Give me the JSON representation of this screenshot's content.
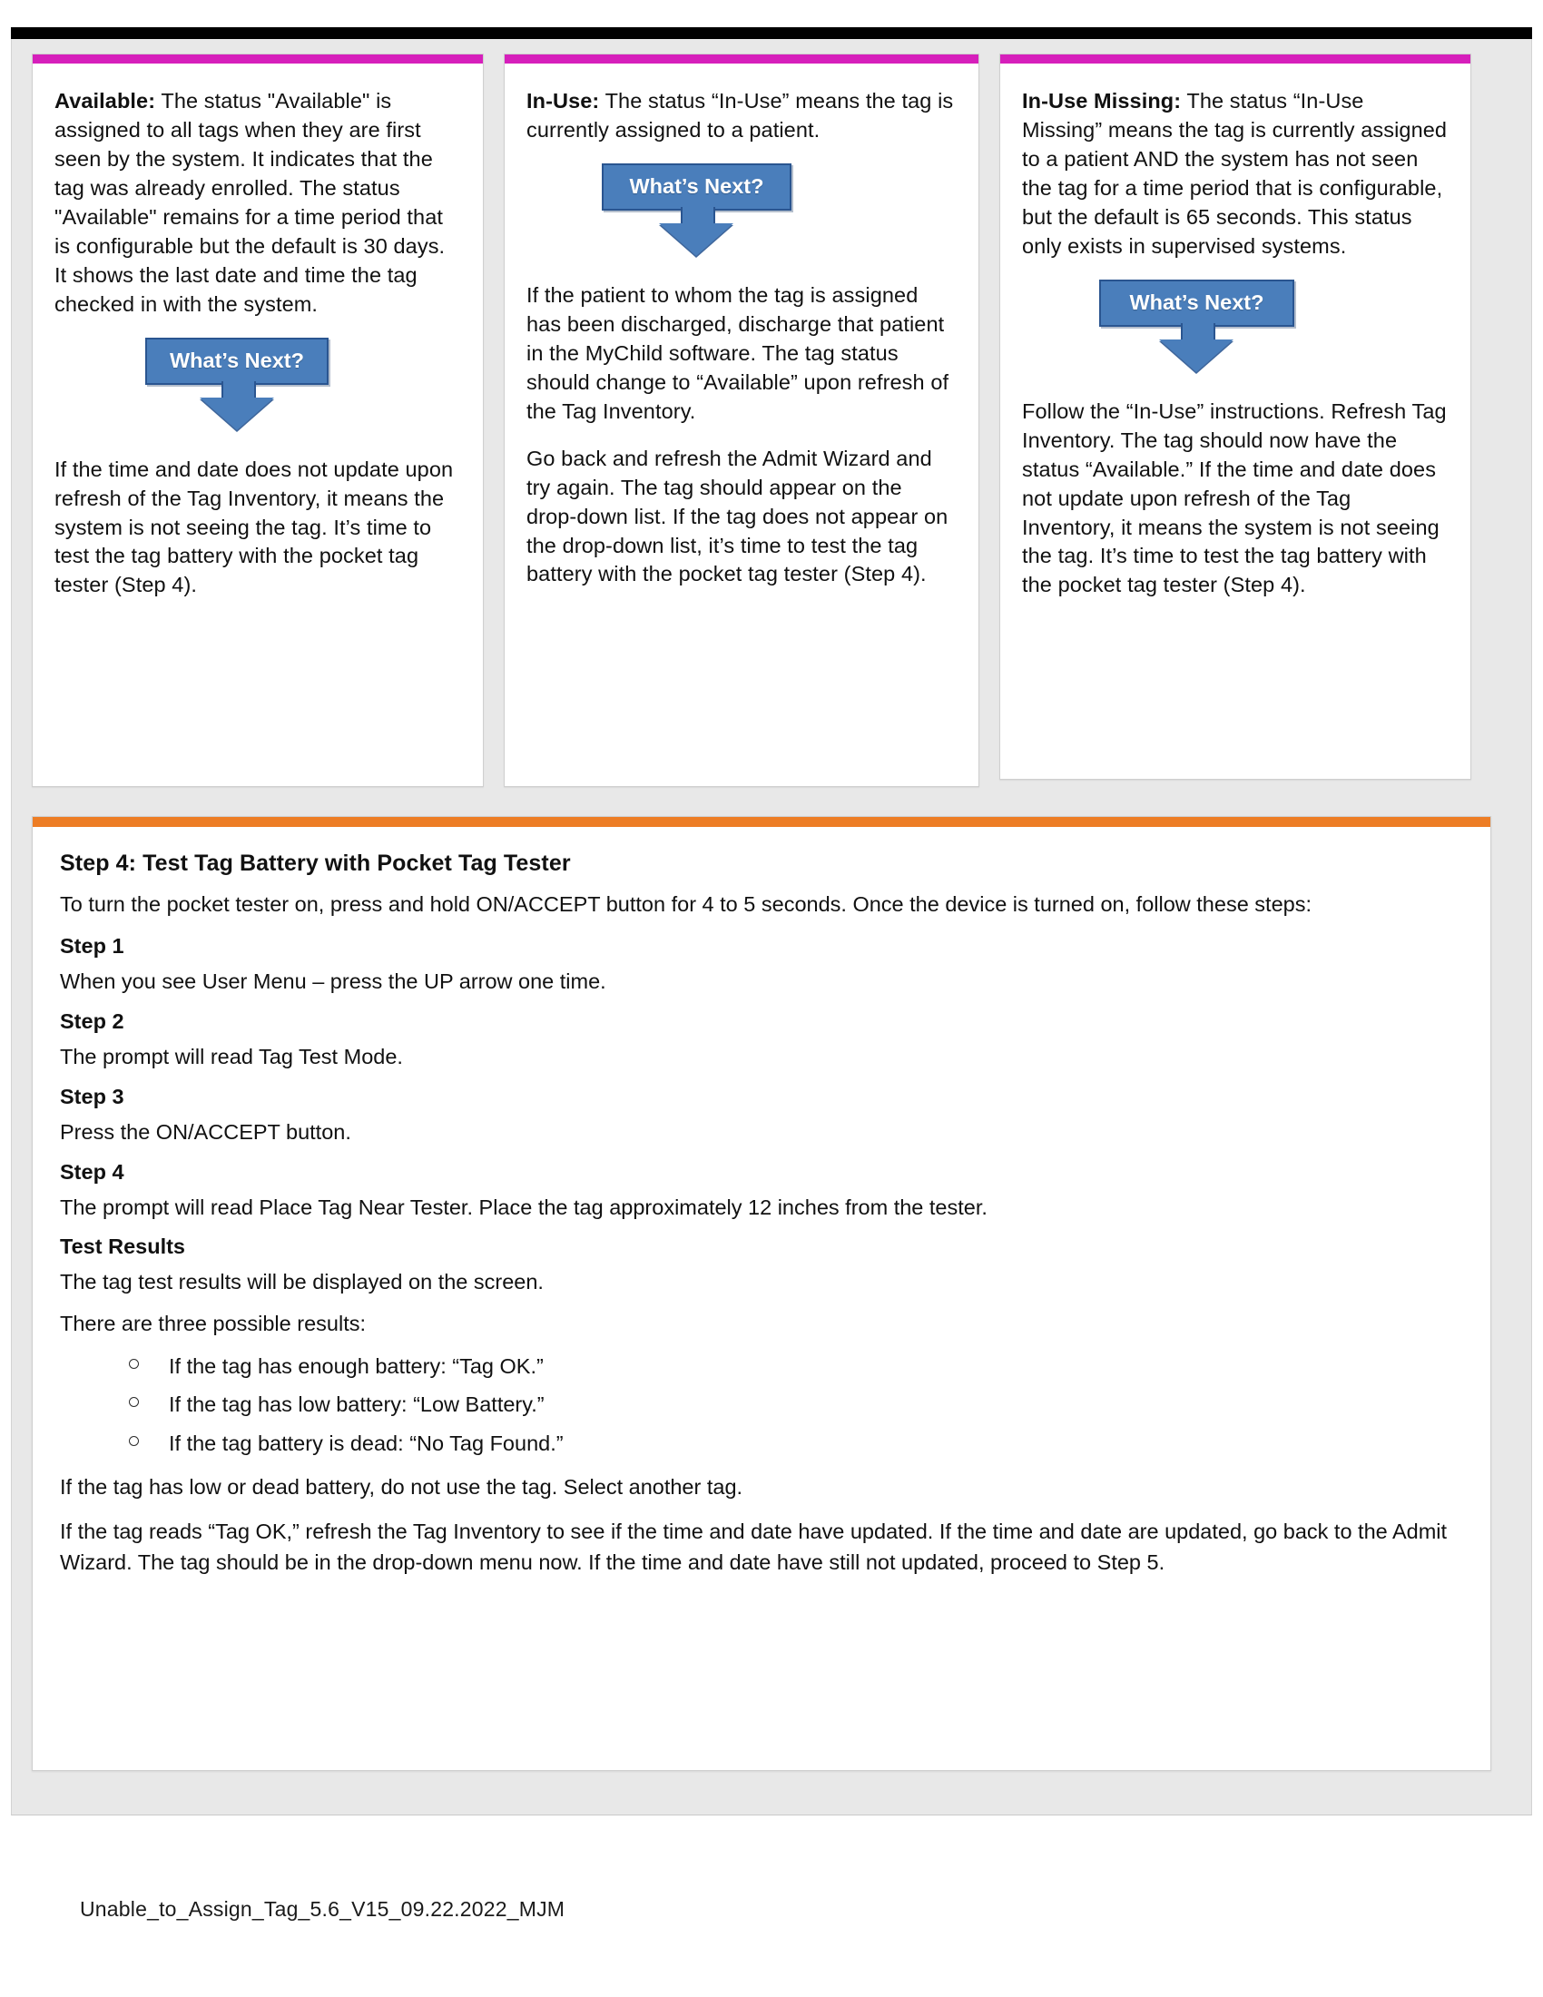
{
  "document": {
    "footer_text": "Unable_to_Assign_Tag_5.6_V15_09.22.2022_MJM",
    "colors": {
      "card_accent": "#d61fbb",
      "step_accent": "#ed7d25",
      "callout_fill": "#4a7ebb",
      "callout_border": "#2a5590",
      "page_background": "#e8e8e8"
    }
  },
  "cards": [
    {
      "id": "available",
      "intro_label": "Available:",
      "intro_text": " The status \"Available\" is assigned to all tags when they are first seen by the system. It indicates that the tag was already enrolled. The status \"Available\" remains for a time period that is configurable but the default is 30 days. It shows the last date and time the tag checked in with the system.",
      "callout_label": "What’s Next?",
      "followup_paragraphs": [
        "If the time and date does not update upon refresh of the Tag Inventory, it means the system is not seeing the tag. It’s time to test the tag battery with the pocket tag tester (Step 4)."
      ]
    },
    {
      "id": "in-use",
      "intro_label": "In-Use:",
      "intro_text": " The status “In-Use” means the tag is currently assigned to a patient.",
      "callout_label": "What’s Next?",
      "followup_paragraphs": [
        "If the patient to whom the tag is assigned has been discharged, discharge that patient in the MyChild software. The tag status should change to “Available” upon refresh of the Tag Inventory.",
        "Go back and refresh the Admit Wizard and try again. The tag should appear on the drop-down list. If the tag does not appear on the drop-down list, it’s time to test the tag battery with the pocket tag tester (Step 4)."
      ]
    },
    {
      "id": "in-use-missing",
      "intro_label": "In-Use Missing:",
      "intro_text": " The status “In-Use Missing” means the tag is currently assigned to a patient AND the system has not seen the tag for a time period that is configurable, but the default is 65 seconds. This status only exists in supervised systems.",
      "callout_label": "What’s Next?",
      "followup_paragraphs": [
        "Follow the “In-Use” instructions. Refresh Tag Inventory. The tag should now have the status “Available.” If the time and date does not update upon refresh of the Tag Inventory, it means the system is not seeing the tag. It’s time to test the tag battery with the pocket tag tester (Step 4)."
      ]
    }
  ],
  "step_panel": {
    "heading": "Step 4: Test Tag Battery with Pocket Tag Tester",
    "intro": "To turn the pocket tester on, press and hold ON/ACCEPT button for 4 to 5 seconds. Once the device is turned on, follow these steps:",
    "steps": [
      {
        "label": "Step 1",
        "text": "When you see User Menu – press the UP arrow one time."
      },
      {
        "label": "Step 2",
        "text": "The prompt will read Tag Test Mode."
      },
      {
        "label": "Step 3",
        "text": "Press the ON/ACCEPT button."
      },
      {
        "label": "Step 4",
        "text": "The prompt will read Place Tag Near Tester. Place the tag approximately 12 inches from the tester."
      }
    ],
    "results_label": "Test Results",
    "results_intro_1": "The tag test results will be displayed on the screen.",
    "results_intro_2": "There are three possible results:",
    "results_items": [
      "If the tag has enough battery: “Tag OK.”",
      "If the tag has low battery: “Low Battery.”",
      "If the tag battery is dead: “No Tag Found.”"
    ],
    "closing_paragraph_1": "If the tag has low or dead battery, do not use the tag. Select another tag.",
    "closing_paragraph_2": "If the tag reads “Tag OK,” refresh the Tag Inventory to see if the time and date have updated. If the time and date are updated, go back to the Admit Wizard. The tag should be in the drop-down menu now. If the time and date have still not updated, proceed to Step 5."
  }
}
